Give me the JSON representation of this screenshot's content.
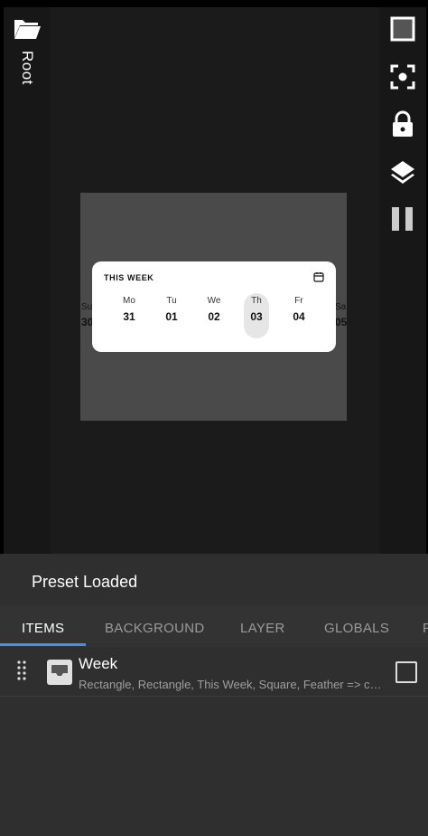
{
  "sidebar_left": {
    "folder_icon": "folder-open-icon",
    "root_label": "Root"
  },
  "toolbar_right": {
    "icons": [
      "square-select-icon",
      "focus-frame-icon",
      "lock-icon",
      "layers-icon",
      "pause-icon"
    ]
  },
  "preview": {
    "card_title": "THIS WEEK",
    "calendar_icon": "calendar-icon",
    "days": [
      {
        "name": "Mo",
        "date": "31"
      },
      {
        "name": "Tu",
        "date": "01"
      },
      {
        "name": "We",
        "date": "02"
      },
      {
        "name": "Th",
        "date": "03",
        "selected": true
      },
      {
        "name": "Fr",
        "date": "04"
      }
    ],
    "peek_left": {
      "name": "Su",
      "date": "30"
    },
    "peek_right": {
      "name": "Sa",
      "date": "05"
    }
  },
  "status": {
    "text": "Preset Loaded"
  },
  "tabs": [
    {
      "label": "ITEMS",
      "active": true
    },
    {
      "label": "BACKGROUND"
    },
    {
      "label": "LAYER"
    },
    {
      "label": "GLOBALS"
    },
    {
      "label": "F"
    }
  ],
  "items": [
    {
      "title": "Week",
      "subtitle": "Rectangle, Rectangle, This Week, Square, Feather => calendar",
      "checked": false
    }
  ],
  "colors": {
    "accent": "#4a90e2",
    "canvas_bg": "#1b1b1b",
    "panel_bg": "#2f2f2f"
  }
}
